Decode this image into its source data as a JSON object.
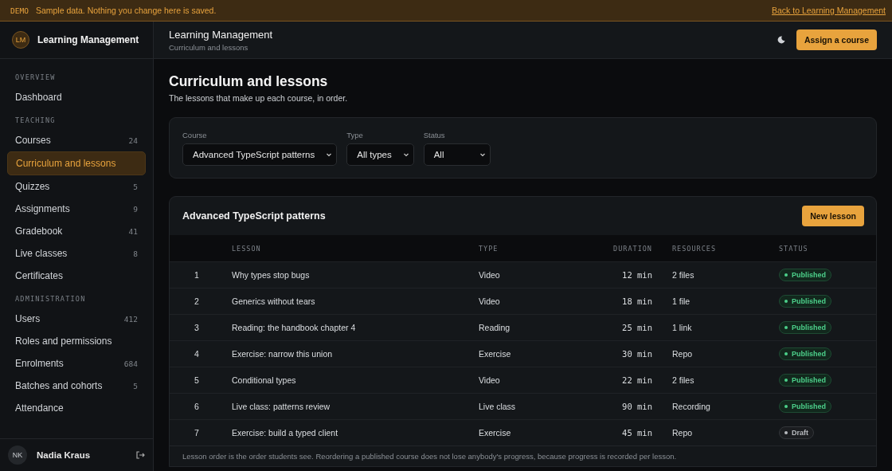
{
  "banner": {
    "tag": "DEMO",
    "message": "Sample data. Nothing you change here is saved.",
    "link": "Back to Learning Management"
  },
  "brand": {
    "initials": "LM",
    "name": "Learning Management"
  },
  "sidebar": {
    "sections": [
      {
        "heading": "OVERVIEW",
        "items": [
          {
            "label": "Dashboard",
            "selected": false
          }
        ]
      },
      {
        "heading": "TEACHING",
        "items": [
          {
            "label": "Courses",
            "count": "24",
            "selected": false
          },
          {
            "label": "Curriculum and lessons",
            "selected": true
          },
          {
            "label": "Quizzes",
            "count": "5",
            "selected": false
          },
          {
            "label": "Assignments",
            "count": "9",
            "selected": false
          },
          {
            "label": "Gradebook",
            "count": "41",
            "selected": false
          },
          {
            "label": "Live classes",
            "count": "8",
            "selected": false
          },
          {
            "label": "Certificates",
            "selected": false
          }
        ]
      },
      {
        "heading": "ADMINISTRATION",
        "items": [
          {
            "label": "Users",
            "count": "412",
            "selected": false
          },
          {
            "label": "Roles and permissions",
            "selected": false
          },
          {
            "label": "Enrolments",
            "count": "684",
            "selected": false
          },
          {
            "label": "Batches and cohorts",
            "count": "5",
            "selected": false
          },
          {
            "label": "Attendance",
            "selected": false
          }
        ]
      }
    ]
  },
  "user": {
    "initials": "NK",
    "name": "Nadia Kraus"
  },
  "header": {
    "title": "Learning Management",
    "subtitle": "Curriculum and lessons",
    "button": "Assign a course"
  },
  "page": {
    "title": "Curriculum and lessons",
    "description": "The lessons that make up each course, in order."
  },
  "filters": [
    {
      "label": "Course",
      "value": "Advanced TypeScript patterns"
    },
    {
      "label": "Type",
      "value": "All types"
    },
    {
      "label": "Status",
      "value": "All"
    }
  ],
  "lessons": {
    "title": "Advanced TypeScript patterns",
    "button": "New lesson",
    "columns": [
      "LESSON",
      "TYPE",
      "DURATION",
      "RESOURCES",
      "STATUS"
    ],
    "rows": [
      {
        "number": "1",
        "lesson": "Why types stop bugs",
        "type": "Video",
        "duration": "12 min",
        "resources": "2 files",
        "status": {
          "label": "Published",
          "kind": "published"
        }
      },
      {
        "number": "2",
        "lesson": "Generics without tears",
        "type": "Video",
        "duration": "18 min",
        "resources": "1 file",
        "status": {
          "label": "Published",
          "kind": "published"
        }
      },
      {
        "number": "3",
        "lesson": "Reading: the handbook chapter 4",
        "type": "Reading",
        "duration": "25 min",
        "resources": "1 link",
        "status": {
          "label": "Published",
          "kind": "published"
        }
      },
      {
        "number": "4",
        "lesson": "Exercise: narrow this union",
        "type": "Exercise",
        "duration": "30 min",
        "resources": "Repo",
        "status": {
          "label": "Published",
          "kind": "published"
        }
      },
      {
        "number": "5",
        "lesson": "Conditional types",
        "type": "Video",
        "duration": "22 min",
        "resources": "2 files",
        "status": {
          "label": "Published",
          "kind": "published"
        }
      },
      {
        "number": "6",
        "lesson": "Live class: patterns review",
        "type": "Live class",
        "duration": "90 min",
        "resources": "Recording",
        "status": {
          "label": "Published",
          "kind": "published"
        }
      },
      {
        "number": "7",
        "lesson": "Exercise: build a typed client",
        "type": "Exercise",
        "duration": "45 min",
        "resources": "Repo",
        "status": {
          "label": "Draft",
          "kind": "draft"
        }
      }
    ],
    "note": "Lesson order is the order students see. Reordering a published course does not lose anybody's progress, because progress is recorded per lesson."
  }
}
